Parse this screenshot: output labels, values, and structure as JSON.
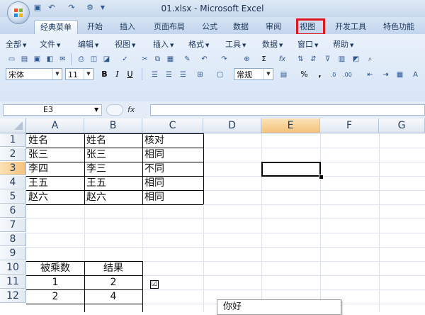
{
  "window": {
    "title": "01.xlsx - Microsoft Excel"
  },
  "qat": {
    "icons": [
      "save-icon",
      "undo-icon",
      "redo-icon",
      "customize-icon"
    ]
  },
  "tabs": [
    "经典菜单",
    "开始",
    "插入",
    "页面布局",
    "公式",
    "数据",
    "审阅",
    "视图",
    "开发工具",
    "特色功能"
  ],
  "active_tab": "经典菜单",
  "highlighted_tab": "视图",
  "menus": [
    "全部",
    "文件",
    "编辑",
    "视图",
    "插入",
    "格式",
    "工具",
    "数据",
    "窗口",
    "帮助"
  ],
  "toolbar": {
    "font_name": "宋体",
    "font_size": "11",
    "bold": "B",
    "italic": "I",
    "underline": "U",
    "number_format": "常规",
    "percent": "%",
    "comma": ",",
    "sigma": "Σ",
    "fx": "fx"
  },
  "formula_bar": {
    "name_box": "E3",
    "fx_label": "fx",
    "content": ""
  },
  "columns": [
    "A",
    "B",
    "C",
    "D",
    "E",
    "F",
    "G"
  ],
  "selected_column": "E",
  "rows": [
    "1",
    "2",
    "3",
    "4",
    "5",
    "6",
    "7",
    "8",
    "9",
    "10",
    "11",
    "12"
  ],
  "selected_row": "3",
  "cells": {
    "A1": "姓名",
    "B1": "姓名",
    "C1": "核对",
    "A2": "张三",
    "B2": "张三",
    "C2": "相同",
    "A3": "李四",
    "B3": "李三",
    "C3": "不同",
    "A4": "王五",
    "B4": "王五",
    "C4": "相同",
    "A5": "赵六",
    "B5": "赵六",
    "C5": "相同",
    "A10": "被乘数",
    "B10": "结果",
    "A11": "1",
    "B11": "2",
    "A12": "2",
    "B12": "4"
  },
  "checkbox": {
    "checked": true,
    "glyph": "☑"
  },
  "tooltip": {
    "text": "你好"
  },
  "colors": {
    "highlight": "#e0171c",
    "selected_header": "#f5c27a"
  }
}
